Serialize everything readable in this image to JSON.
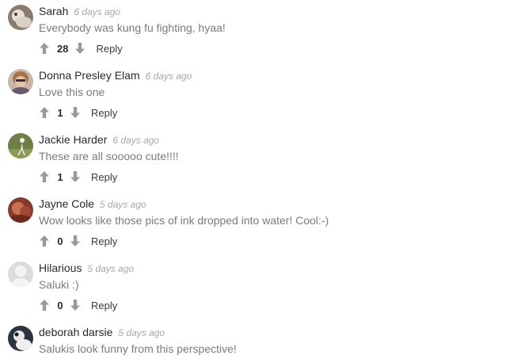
{
  "comments": [
    {
      "author": "Sarah",
      "time": "6 days ago",
      "text": "Everybody was kung fu fighting, hyaa!",
      "votes": "28",
      "reply_label": "Reply",
      "avatar_icon": "user-photo-avatar"
    },
    {
      "author": "Donna Presley Elam",
      "time": "6 days ago",
      "text": "Love this one",
      "votes": "1",
      "reply_label": "Reply",
      "avatar_icon": "user-photo-avatar"
    },
    {
      "author": "Jackie Harder",
      "time": "6 days ago",
      "text": "These are all sooooo cute!!!!",
      "votes": "1",
      "reply_label": "Reply",
      "avatar_icon": "user-photo-avatar"
    },
    {
      "author": "Jayne Cole",
      "time": "5 days ago",
      "text": "Wow looks like those pics of ink dropped into water! Cool:-)",
      "votes": "0",
      "reply_label": "Reply",
      "avatar_icon": "user-photo-avatar"
    },
    {
      "author": "Hilarious",
      "time": "5 days ago",
      "text": "Saluki :)",
      "votes": "0",
      "reply_label": "Reply",
      "avatar_icon": "default-avatar"
    },
    {
      "author": "deborah darsie",
      "time": "5 days ago",
      "text": "Salukis look funny from this perspective!",
      "votes": "",
      "reply_label": "",
      "avatar_icon": "user-photo-avatar"
    }
  ],
  "colors": {
    "author": "#2a2a2a",
    "timestamp": "#a7a7a7",
    "body": "#7b7b7b",
    "vote_icon": "#9a9a9a"
  },
  "icons": {
    "upvote": "arrow-up-icon",
    "downvote": "arrow-down-icon"
  }
}
